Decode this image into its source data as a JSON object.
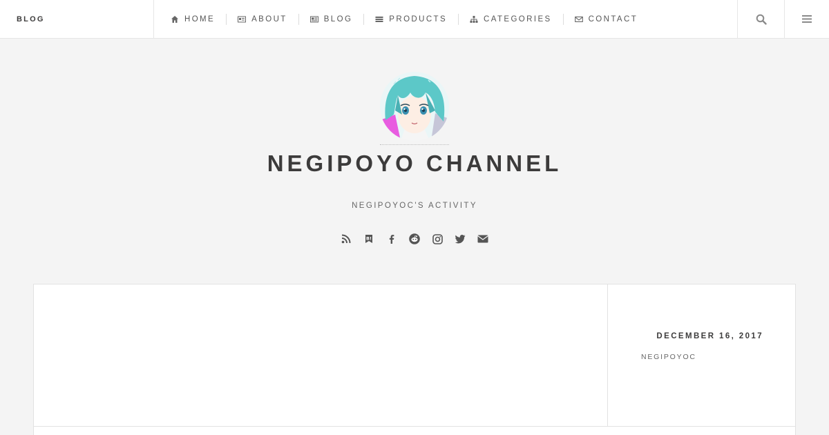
{
  "header": {
    "brand": "BLOG",
    "nav": [
      {
        "label": "HOME",
        "icon": "home-icon"
      },
      {
        "label": "ABOUT",
        "icon": "id-card-icon"
      },
      {
        "label": "BLOG",
        "icon": "newspaper-icon"
      },
      {
        "label": "PRODUCTS",
        "icon": "list-icon"
      },
      {
        "label": "CATEGORIES",
        "icon": "sitemap-icon"
      },
      {
        "label": "CONTACT",
        "icon": "envelope-icon"
      }
    ],
    "search_icon": "search-icon",
    "menu_icon": "hamburger-menu-icon"
  },
  "hero": {
    "avatar": "anime-character-avatar",
    "title": "NEGIPOYO CHANNEL",
    "tagline": "NEGIPOYOC'S ACTIVITY",
    "social": [
      "rss-icon",
      "hatena-bookmark-icon",
      "facebook-icon",
      "reddit-icon",
      "instagram-icon",
      "twitter-icon",
      "envelope-icon"
    ]
  },
  "post": {
    "date": "DECEMBER 16, 2017",
    "author": "NEGIPOYOC"
  },
  "colors": {
    "background": "#f4f4f4",
    "text": "#3c3b3b",
    "border": "#e2e2e2",
    "avatar_hair": "#5cc8c8",
    "avatar_accent": "#e85ce0"
  }
}
